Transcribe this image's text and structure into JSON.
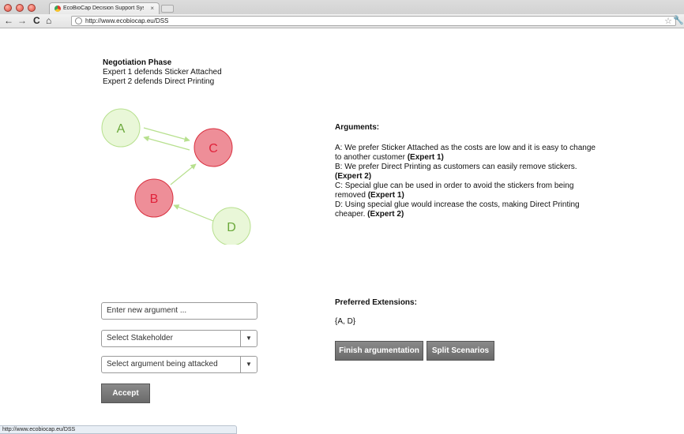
{
  "browser": {
    "tab_title": "EcoBioCap Decision Support Sys",
    "tab_close": "×",
    "url": "http://www.ecobiocap.eu/DSS",
    "status_url": "http://www.ecobiocap.eu/DSS"
  },
  "phase": {
    "title": "Negotiation Phase",
    "line1": "Expert 1 defends Sticker Attached",
    "line2": "Expert 2 defends Direct Printing"
  },
  "graph": {
    "nodes": [
      {
        "label": "A",
        "color": "#e9f7d8",
        "stroke": "#b7e08e",
        "text": "#6aa83a"
      },
      {
        "label": "B",
        "color": "#ee8e98",
        "stroke": "#d9303f",
        "text": "#e0223a"
      },
      {
        "label": "C",
        "color": "#ee8e98",
        "stroke": "#d9303f",
        "text": "#e0223a"
      },
      {
        "label": "D",
        "color": "#e9f7d8",
        "stroke": "#b7e08e",
        "text": "#6aa83a"
      }
    ],
    "edge_color": "#b7e08e"
  },
  "arguments": {
    "heading": "Arguments:",
    "a_text": "A: We prefer Sticker Attached as the costs are low and it is easy to change to another customer",
    "a_expert": "(Expert 1)",
    "b_text": "B: We prefer Direct Printing as customers can easily remove stickers.",
    "b_expert": "(Expert 2)",
    "c_text": "C: Special glue can be used in order to avoid the stickers from being removed",
    "c_expert": "(Expert 1)",
    "d_text": "D: Using special glue would increase the costs, making Direct Printing cheaper.",
    "d_expert": "(Expert 2)"
  },
  "preferred": {
    "heading": "Preferred Extensions:",
    "value": "{A, D}"
  },
  "buttons": {
    "finish": "Finish argumentation",
    "split": "Split Scenarios",
    "accept": "Accept"
  },
  "form": {
    "argument_placeholder": "Enter new argument ...",
    "stakeholder": "Select Stakeholder",
    "attacked": "Select argument being attacked",
    "dropdown_arrow": "▼"
  }
}
